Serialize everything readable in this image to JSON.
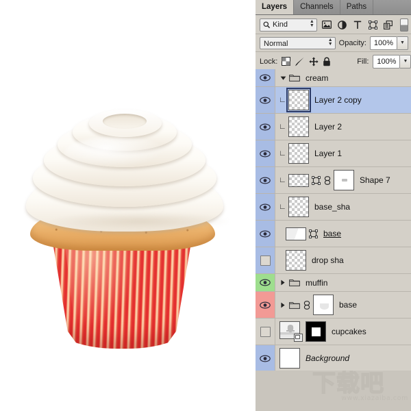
{
  "panel": {
    "tabs": [
      {
        "label": "Layers",
        "active": true
      },
      {
        "label": "Channels",
        "active": false
      },
      {
        "label": "Paths",
        "active": false
      }
    ],
    "filter": {
      "kind_label": "Kind",
      "search_icon": "magnifier-icon",
      "type_filters": [
        {
          "name": "pixel-filter-icon"
        },
        {
          "name": "adjustment-filter-icon"
        },
        {
          "name": "type-filter-icon"
        },
        {
          "name": "shape-filter-icon"
        },
        {
          "name": "smart-object-filter-icon"
        }
      ],
      "toggle_name": "filter-toggle-switch"
    },
    "blend": {
      "mode": "Normal",
      "opacity_label": "Opacity:",
      "opacity_value": "100%"
    },
    "lock": {
      "label": "Lock:",
      "icons": [
        {
          "name": "lock-transparent-pixels-icon"
        },
        {
          "name": "lock-image-pixels-icon"
        },
        {
          "name": "lock-position-icon"
        },
        {
          "name": "lock-all-icon"
        }
      ],
      "fill_label": "Fill:",
      "fill_value": "100%"
    },
    "layers": [
      {
        "name": "cream",
        "kind": "group",
        "visible": true,
        "expanded": true,
        "selected": false,
        "eye_color": "blue",
        "height": "25"
      },
      {
        "name": "Layer 2 copy",
        "kind": "pixel",
        "visible": true,
        "clipped": true,
        "selected": true,
        "eye_color": "blue",
        "thumb": "transparent"
      },
      {
        "name": "Layer 2",
        "kind": "pixel",
        "visible": true,
        "clipped": true,
        "selected": false,
        "eye_color": "blue",
        "thumb": "transparent"
      },
      {
        "name": "Layer 1",
        "kind": "pixel",
        "visible": true,
        "clipped": true,
        "selected": false,
        "eye_color": "blue",
        "thumb": "transparent"
      },
      {
        "name": "Shape 7",
        "kind": "shape",
        "visible": true,
        "clipped": true,
        "selected": false,
        "eye_color": "blue",
        "linked": true,
        "has_vector_mask": true,
        "has_second_thumb": true
      },
      {
        "name": "base_sha",
        "kind": "pixel",
        "visible": true,
        "clipped": true,
        "selected": false,
        "eye_color": "blue",
        "thumb": "transparent"
      },
      {
        "name": "base",
        "kind": "shape",
        "visible": true,
        "clipped": false,
        "selected": false,
        "eye_color": "blue",
        "renaming": true,
        "has_vector_mask": true
      },
      {
        "name": "drop sha",
        "kind": "pixel",
        "visible": false,
        "clipped": false,
        "selected": false,
        "eye_color": "blue",
        "thumb": "transparent"
      },
      {
        "name": "muffin",
        "kind": "group",
        "visible": true,
        "expanded": false,
        "selected": false,
        "eye_color": "green"
      },
      {
        "name": "base",
        "kind": "group",
        "visible": true,
        "expanded": false,
        "selected": false,
        "eye_color": "red",
        "linked": true,
        "has_group_thumb": true
      },
      {
        "name": "cupcakes",
        "kind": "smart-object",
        "visible": false,
        "selected": false,
        "eye_color": "none",
        "has_mask": true
      },
      {
        "name": "Background",
        "kind": "background",
        "visible": true,
        "selected": false,
        "eye_color": "blue",
        "italic": true
      }
    ]
  },
  "canvas": {
    "artwork_name": "cupcake-illustration"
  },
  "watermark": {
    "text": "下载吧",
    "url": "www.xiazaiba.com"
  },
  "colors": {
    "panel_bg": "#d4d0c8",
    "selected_row": "#b3c6ea",
    "eye_blue": "#a8bce4",
    "eye_green": "#9ede8e",
    "eye_red": "#f29a95"
  }
}
